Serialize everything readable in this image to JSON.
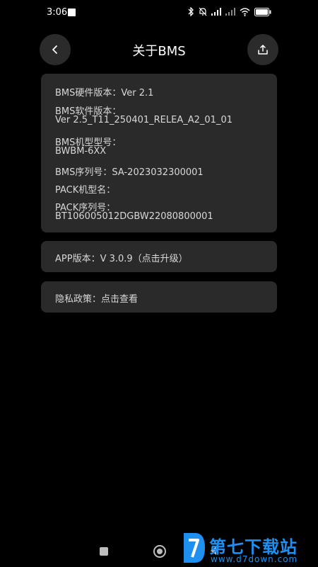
{
  "status_bar": {
    "time": "3:06",
    "battery": "100",
    "icons": [
      "notification-square-icon",
      "bluetooth-icon",
      "mute-bell-icon",
      "signal-icon",
      "signal-icon",
      "wifi-icon",
      "battery-icon"
    ]
  },
  "header": {
    "title": "关于BMS",
    "back_icon": "chevron-left-icon",
    "share_icon": "share-icon"
  },
  "info_card": {
    "hardware_version": "BMS硬件版本：Ver 2.1",
    "software_version_label": "BMS软件版本：",
    "software_version_value": "Ver 2.5_T11_250401_RELEA_A2_01_01",
    "model_label": "BMS机型型号：",
    "model_value": "BWBM-6XX",
    "serial": "BMS序列号：SA-2023032300001",
    "pack_model": "PACK机型名：",
    "pack_serial_label": "PACK序列号：",
    "pack_serial_value": "BT106005012DGBW22080800001"
  },
  "app_version": "APP版本：V 3.0.9（点击升级）",
  "privacy_policy": "隐私政策：点击查看",
  "watermark": {
    "text": "第七下载站",
    "url": "www.d7down.com"
  },
  "colors": {
    "background": "#000000",
    "card": "#2a2a2a",
    "button": "#2b2b2b",
    "watermark": "#1f8ff0"
  }
}
